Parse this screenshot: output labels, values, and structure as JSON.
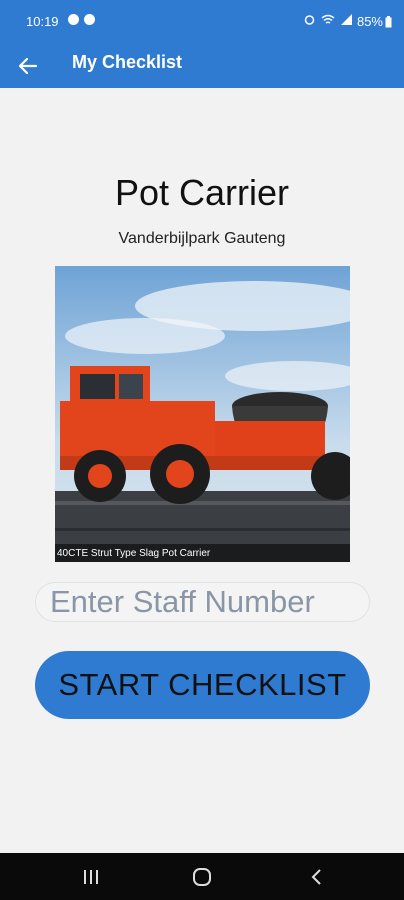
{
  "status_bar": {
    "time": "10:19",
    "battery": "85%",
    "left_icons": [
      "facebook-icon",
      "notification-icon"
    ],
    "right_icons": [
      "alarm-icon",
      "wifi-icon",
      "signal-icon"
    ]
  },
  "app_bar": {
    "title": "My Checklist",
    "back_icon": "arrow-left-icon",
    "color": "#2f7bd1"
  },
  "main": {
    "title": "Pot Carrier",
    "subtitle": "Vanderbijlpark Gauteng",
    "image_caption": "40CTE Strut Type Slag Pot Carrier",
    "staff_input": {
      "placeholder": "Enter Staff Number",
      "value": ""
    },
    "start_button_label": "START CHECKLIST"
  },
  "nav_bar": {
    "buttons": [
      "recent-apps-icon",
      "home-icon",
      "back-icon"
    ]
  }
}
